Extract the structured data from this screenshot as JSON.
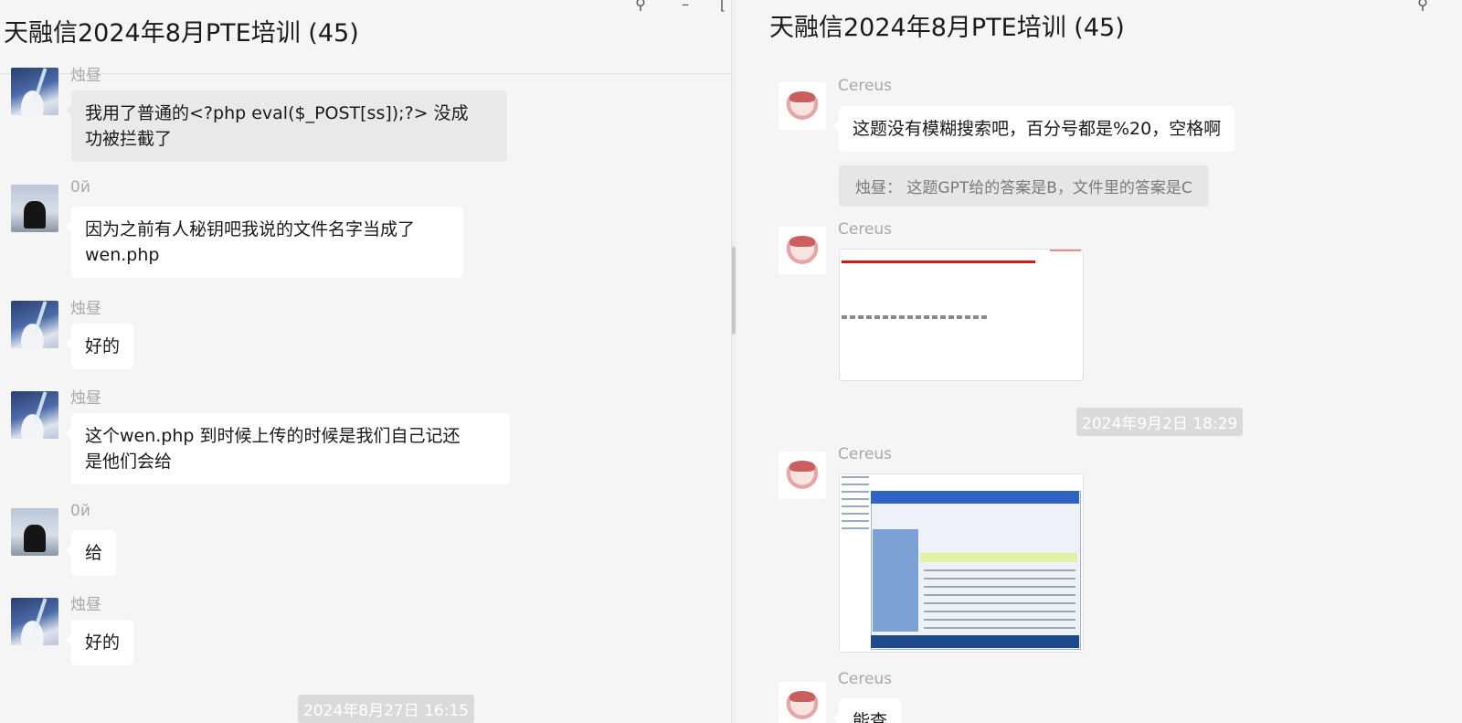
{
  "left": {
    "title": "天融信2024年8月PTE培训 (45)",
    "window_controls": {
      "pin_icon": "pin-icon",
      "minimize_icon": "minimize-icon",
      "maximize_icon": "maximize-icon"
    },
    "messages": [
      {
        "sender": "烛昼",
        "avatar": "snow-avatar",
        "text_lines": [
          "我用了普通的<?php eval($_POST[ss]);?>  没成",
          "功被拦截了"
        ]
      },
      {
        "sender": "0й",
        "avatar": "horse-avatar",
        "text_lines": [
          "因为之前有人秘钥吧我说的文件名字当成了",
          "wen.php"
        ]
      },
      {
        "sender": "烛昼",
        "avatar": "snow-avatar",
        "text_lines": [
          "好的"
        ]
      },
      {
        "sender": "烛昼",
        "avatar": "snow-avatar",
        "text_lines": [
          "这个wen.php 到时候上传的时候是我们自己记还",
          "是他们会给"
        ]
      },
      {
        "sender": "0й",
        "avatar": "horse-avatar",
        "text_lines": [
          "给"
        ]
      },
      {
        "sender": "烛昼",
        "avatar": "snow-avatar",
        "text_lines": [
          "好的"
        ]
      }
    ],
    "timestamp": "2024年8月27日 16:15"
  },
  "right": {
    "title": "天融信2024年8月PTE培训 (45)",
    "messages": [
      {
        "sender": "Cereus",
        "avatar": "cereus-avatar",
        "text": "这题没有模糊搜索吧，百分号都是%20，空格啊",
        "quote": "烛昼： 这题GPT给的答案是B，文件里的答案是C"
      },
      {
        "sender": "Cereus",
        "avatar": "cereus-avatar",
        "image": "screenshot-thumbnail"
      },
      {
        "sender": "Cereus",
        "avatar": "cereus-avatar",
        "image": "desktop-screenshot-thumbnail"
      },
      {
        "sender": "Cereus",
        "avatar": "cereus-avatar",
        "text": "能查"
      }
    ],
    "timestamp": "2024年9月2日 18:29"
  },
  "colors": {
    "background": "#f5f5f5",
    "bubble": "#ffffff",
    "quote_bubble": "#e6e6e6",
    "sender_text": "#a8a8a8",
    "timestamp_bg": "#dadada"
  }
}
